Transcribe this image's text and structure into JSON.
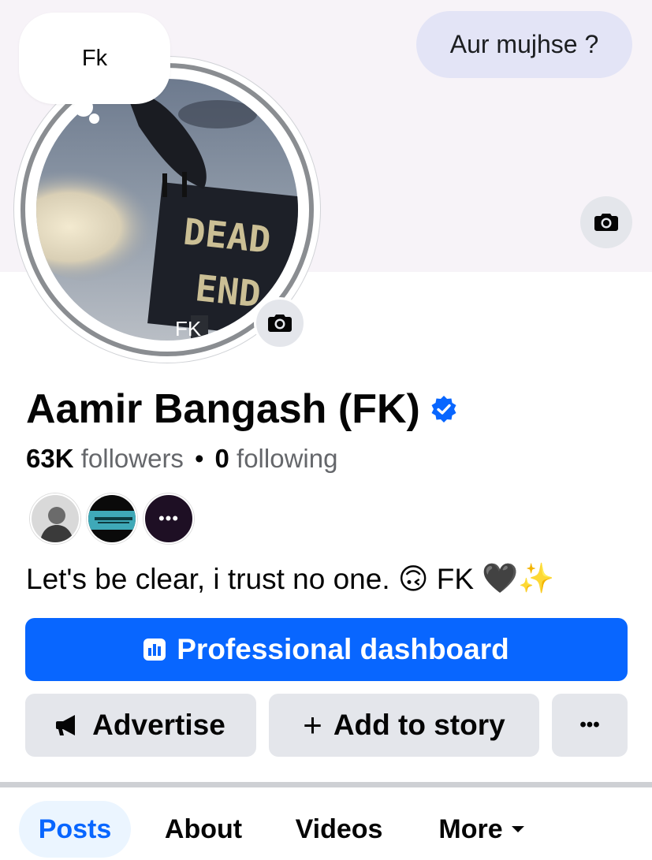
{
  "cover": {
    "bubble_text": "Aur mujhse ?"
  },
  "note": {
    "text": "Fk"
  },
  "avatar": {
    "overlay_text": "FK",
    "sign_line1": "DEAD",
    "sign_line2": "END"
  },
  "profile": {
    "name": "Aamir Bangash (FK)",
    "followers_count": "63K",
    "followers_label": "followers",
    "separator": "•",
    "following_count": "0",
    "following_label": "following",
    "bio_text": "Let's be clear, i trust no one.",
    "bio_emoji1": "🙃",
    "bio_fk": "FK",
    "bio_emoji2": "🖤",
    "bio_emoji3": "✨",
    "more_friends": "•••"
  },
  "actions": {
    "primary_label": "Professional dashboard",
    "advertise_label": "Advertise",
    "add_story_label": "Add to story",
    "add_story_prefix": "+",
    "more_label": "•••"
  },
  "tabs": [
    {
      "label": "Posts",
      "active": true
    },
    {
      "label": "About",
      "active": false
    },
    {
      "label": "Videos",
      "active": false
    },
    {
      "label": "More",
      "active": false
    }
  ],
  "colors": {
    "accent": "#0866ff",
    "button_bg": "#e4e6eb",
    "verified": "#0866ff"
  },
  "icons": {
    "camera": "camera-icon",
    "verified": "verified-badge-icon",
    "dashboard": "bar-chart-icon",
    "advertise": "megaphone-icon",
    "dropdown": "caret-down-icon"
  }
}
